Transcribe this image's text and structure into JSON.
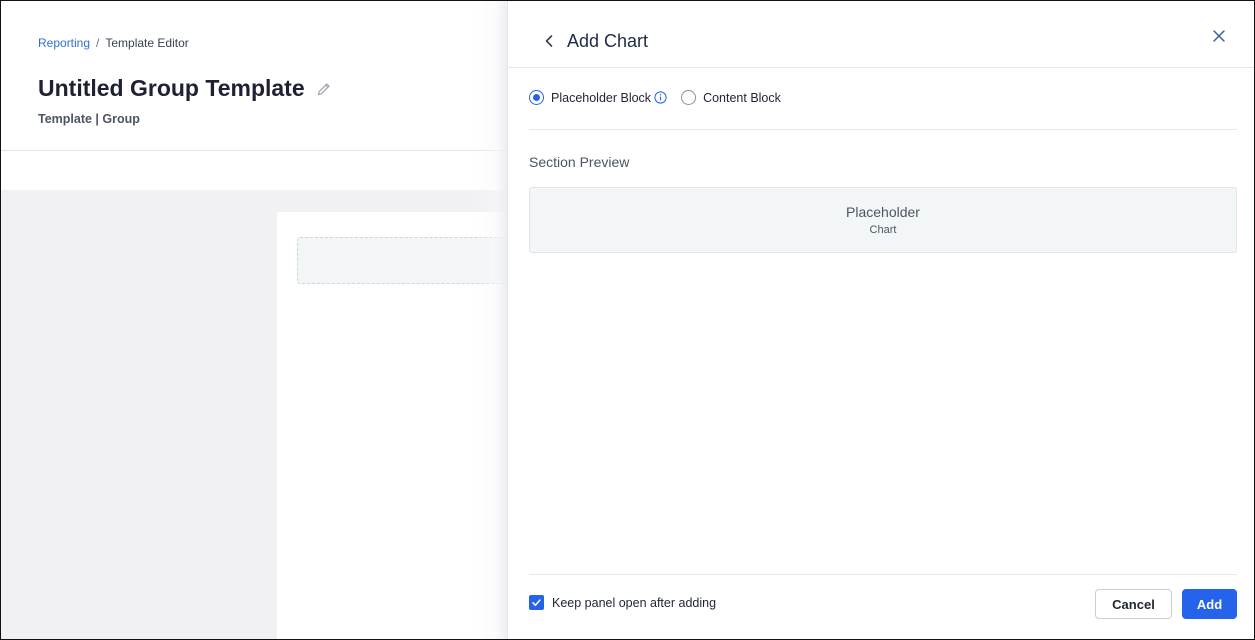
{
  "breadcrumb": {
    "root": "Reporting",
    "separator": "/",
    "current": "Template Editor"
  },
  "page": {
    "title": "Untitled Group Template",
    "subtitle": "Template | Group"
  },
  "panel": {
    "title": "Add Chart",
    "block_options": [
      {
        "label": "Placeholder Block",
        "selected": true
      },
      {
        "label": "Content Block",
        "selected": false
      }
    ],
    "section_label": "Section Preview",
    "preview": {
      "title": "Placeholder",
      "subtitle": "Chart"
    },
    "keep_open": {
      "label": "Keep panel open after adding",
      "checked": true
    },
    "cancel_label": "Cancel",
    "add_label": "Add"
  },
  "colors": {
    "accent": "#2563eb",
    "link": "#2f6fd6",
    "canvas_bg": "#f1f1f4",
    "preview_bg": "#f3f6f7"
  },
  "icons": {
    "back": "chevron-left-icon",
    "close": "close-icon",
    "edit": "pencil-icon",
    "info": "info-icon",
    "check": "check-icon"
  }
}
